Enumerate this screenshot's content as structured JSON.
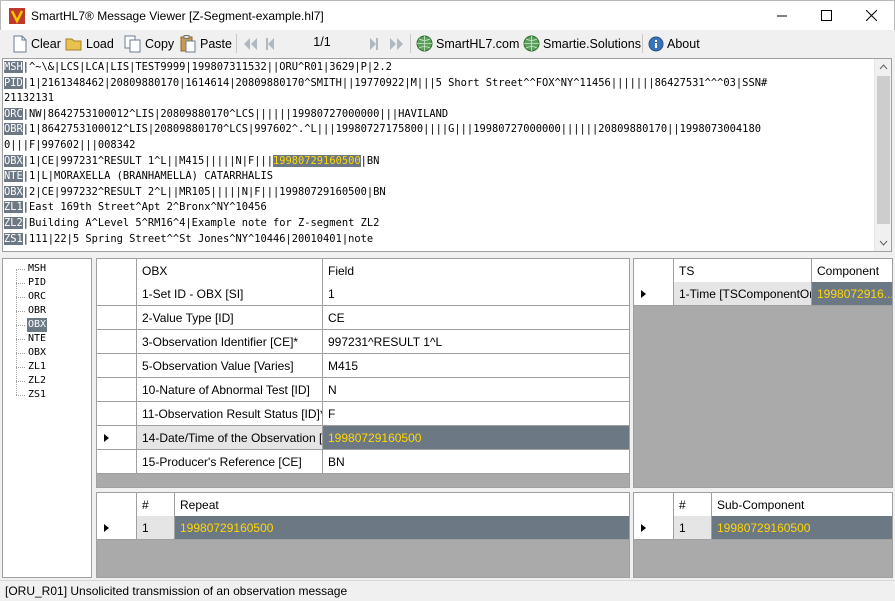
{
  "window": {
    "title": "SmartHL7® Message Viewer [Z-Segment-example.hl7]"
  },
  "toolbar": {
    "clear": "Clear",
    "load": "Load",
    "copy": "Copy",
    "paste": "Paste",
    "page_indicator": "1/1",
    "smarthl7_link": "SmartHL7.com",
    "smartie_link": "Smartie.Solutions",
    "about": "About"
  },
  "message": {
    "lines": [
      {
        "seg": "MSH",
        "rest": "|^~\\&|LCS|LCA|LIS|TEST9999|199807311532||ORU^R01|3629|P|2.2"
      },
      {
        "seg": "PID",
        "rest": "|1|2161348462|20809880170|1614614|20809880170^SMITH||19770922|M|||5 Short Street^^FOX^NY^11456|||||||86427531^^^03|SSN#"
      },
      {
        "seg": "",
        "rest": "21132131"
      },
      {
        "seg": "ORC",
        "rest": "|NW|8642753100012^LIS|20809880170^LCS||||||19980727000000|||HAVILAND"
      },
      {
        "seg": "OBR",
        "rest": "|1|8642753100012^LIS|20809880170^LCS|997602^.^L|||19980727175800||||G|||19980727000000||||||20809880170||1998073004180"
      },
      {
        "seg": "",
        "rest": "0|||F|997602|||008342"
      },
      {
        "seg": "OBX",
        "rest": "|1|CE|997231^RESULT 1^L||M415|||||N|F|||",
        "hl": "19980729160500",
        "after": "|BN"
      },
      {
        "seg": "NTE",
        "rest": "|1|L|MORAXELLA (BRANHAMELLA) CATARRHALIS"
      },
      {
        "seg": "OBX",
        "rest": "|2|CE|997232^RESULT 2^L||MR105|||||N|F|||19980729160500|BN"
      },
      {
        "seg": "ZL1",
        "rest": "|East 169th Street^Apt 2^Bronx^NY^10456"
      },
      {
        "seg": "ZL2",
        "rest": "|Building A^Level 5^RM16^4|Example note for Z-segment ZL2"
      },
      {
        "seg": "ZS1",
        "rest": "|111|22|5 Spring Street^^St Jones^NY^10446|20010401|note"
      }
    ]
  },
  "tree": {
    "items": [
      "MSH",
      "PID",
      "ORC",
      "OBR",
      "OBX",
      "NTE",
      "OBX",
      "ZL1",
      "ZL2",
      "ZS1"
    ],
    "selected_index": 4
  },
  "field_grid": {
    "headers": [
      "OBX",
      "Field"
    ],
    "rows": [
      {
        "name": "1-Set ID - OBX [SI]",
        "value": "1"
      },
      {
        "name": "2-Value Type [ID]",
        "value": "CE"
      },
      {
        "name": "3-Observation Identifier [CE]*",
        "value": "997231^RESULT 1^L"
      },
      {
        "name": "5-Observation Value [Varies]",
        "value": "M415"
      },
      {
        "name": "10-Nature of Abnormal Test [ID]",
        "value": "N"
      },
      {
        "name": "11-Observation Result Status [ID]*",
        "value": "F"
      },
      {
        "name": "14-Date/Time of the Observation [TS]",
        "value": "19980729160500"
      },
      {
        "name": "15-Producer's Reference [CE]",
        "value": "BN"
      }
    ],
    "selected_index": 6
  },
  "component_grid": {
    "headers": [
      "TS",
      "Component"
    ],
    "rows": [
      {
        "name": "1-Time [TSComponentOne]",
        "value": "1998072916..."
      }
    ]
  },
  "repeat_grid": {
    "headers": [
      "#",
      "Repeat"
    ],
    "rows": [
      {
        "num": "1",
        "value": "19980729160500"
      }
    ]
  },
  "subcomponent_grid": {
    "headers": [
      "#",
      "Sub-Component"
    ],
    "rows": [
      {
        "num": "1",
        "value": "19980729160500"
      }
    ]
  },
  "status": {
    "text": "[ORU_R01] Unsolicited transmission of an observation message"
  },
  "colors": {
    "selection": "#6d7885",
    "highlight_text": "#ffd800"
  }
}
